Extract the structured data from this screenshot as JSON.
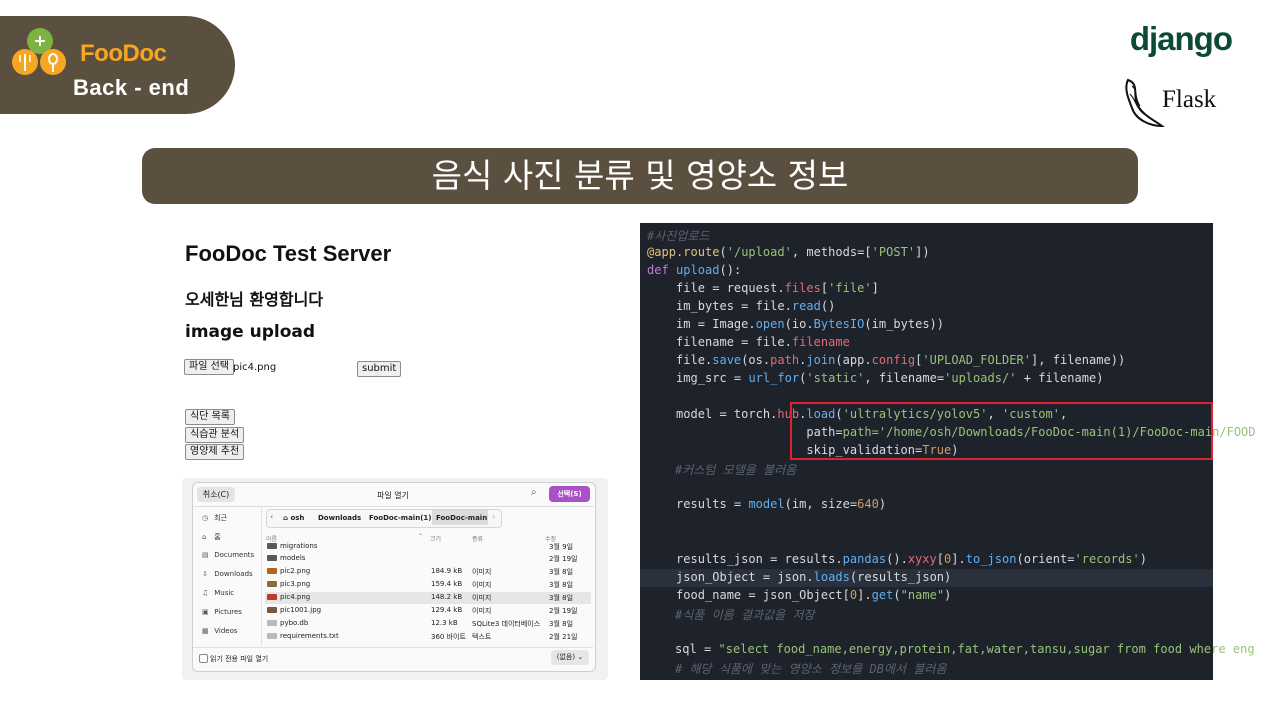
{
  "badge": {
    "brand": "FooDoc",
    "subtitle": "Back - end"
  },
  "logos": {
    "django": "django",
    "flask": "Flask"
  },
  "title": "음식 사진 분류 및 영양소 정보",
  "server": {
    "title": "FooDoc Test Server",
    "welcome": "오세한님 환영합니다",
    "upload_heading": "image upload",
    "file_button": "파일 선택",
    "file_name": "pic4.png",
    "submit": "submit",
    "buttons": [
      "식단 목록",
      "식습관 분석",
      "영양제 추천"
    ]
  },
  "dialog": {
    "cancel": "취소(C)",
    "title": "파일 열기",
    "select": "선택(S)",
    "sidebar": [
      {
        "icon": "clock-icon",
        "glyph": "◷",
        "label": "최근"
      },
      {
        "icon": "home-icon",
        "glyph": "⌂",
        "label": "홈"
      },
      {
        "icon": "document-icon",
        "glyph": "▤",
        "label": "Documents"
      },
      {
        "icon": "download-icon",
        "glyph": "⇩",
        "label": "Downloads"
      },
      {
        "icon": "music-icon",
        "glyph": "♫",
        "label": "Music"
      },
      {
        "icon": "picture-icon",
        "glyph": "▣",
        "label": "Pictures"
      },
      {
        "icon": "video-icon",
        "glyph": "▦",
        "label": "Videos"
      }
    ],
    "path": [
      "osh",
      "Downloads",
      "FooDoc-main(1)",
      "FooDoc-main"
    ],
    "columns": {
      "name": "이름",
      "size": "크기",
      "type": "종류",
      "modified": "수정"
    },
    "files": [
      {
        "name": "migrations",
        "size": "",
        "type": "",
        "date": "3월 9일",
        "icon": "folder-icon",
        "color": "#5a5a5a"
      },
      {
        "name": "models",
        "size": "",
        "type": "",
        "date": "2월 19일",
        "icon": "folder-icon",
        "color": "#5a5a5a"
      },
      {
        "name": "pic2.png",
        "size": "184.9 kB",
        "type": "이미지",
        "date": "3월 8일",
        "icon": "image-icon",
        "color": "#b5651d"
      },
      {
        "name": "pic3.png",
        "size": "159.4 kB",
        "type": "이미지",
        "date": "3월 8일",
        "icon": "image-icon",
        "color": "#8a6d3b"
      },
      {
        "name": "pic4.png",
        "size": "148.2 kB",
        "type": "이미지",
        "date": "3월 8일",
        "icon": "image-icon",
        "color": "#c0392b"
      },
      {
        "name": "pic1001.jpg",
        "size": "129.4 kB",
        "type": "이미지",
        "date": "2월 19일",
        "icon": "image-icon",
        "color": "#7d5a3c"
      },
      {
        "name": "pybo.db",
        "size": "12.3 kB",
        "type": "SQLite3 데이터베이스",
        "date": "3월 8일",
        "icon": "file-icon",
        "color": "#bbbbbb"
      },
      {
        "name": "requirements.txt",
        "size": "360 바이트",
        "type": "텍스트",
        "date": "2월 21일",
        "icon": "file-icon",
        "color": "#bbbbbb"
      }
    ],
    "selected_index": 4,
    "readonly_label": "읽기 전용 파일 열기",
    "filter": "(없음)"
  },
  "code": {
    "l1": "#사진업로드",
    "l12b": "model = torch.hub.load('ultralytics/yolov5', 'custom',",
    "l13": "path='/home/osh/Downloads/FooDoc-main(1)/FooDoc-main/FOOD",
    "l14": "skip_validation=True)",
    "l15": "#커스텀 모델을 불러옴",
    "l23": "#식품 이름 결과값을 저장",
    "l25": "sql = \"select food_name,energy,protein,fat,water,tansu,sugar from food where eng",
    "l26": "# 해당 식품에 맞는 영양소 정보를 DB에서 불러옴"
  },
  "colors": {
    "badge_bg": "#5b4f3f",
    "brand_orange": "#f5a623",
    "django_green": "#0c4b33",
    "highlight_red": "#e0202e",
    "select_purple": "#a951c6"
  }
}
